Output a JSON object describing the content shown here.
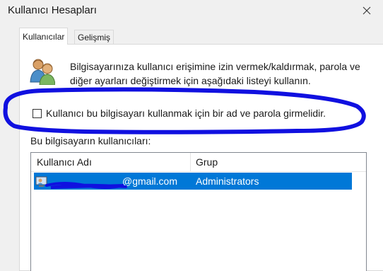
{
  "window": {
    "title": "Kullanıcı Hesapları",
    "close_icon": "close-icon"
  },
  "tabs": [
    {
      "label": "Kullanıcılar",
      "active": true
    },
    {
      "label": "Gelişmiş",
      "active": false
    }
  ],
  "description": "Bilgisayarınıza kullanıcı erişimine izin vermek/kaldırmak, parola ve diğer ayarları değiştirmek için aşağıdaki listeyi kullanın.",
  "require_password": {
    "label": "Kullanıcı bu bilgisayarı kullanmak için bir ad ve parola girmelidir.",
    "checked": false
  },
  "users_section": {
    "label": "Bu bilgisayarın kullanıcıları:",
    "columns": [
      "Kullanıcı Adı",
      "Grup"
    ],
    "rows": [
      {
        "user": "@gmail.com",
        "group": "Administrators",
        "selected": true
      }
    ]
  },
  "colors": {
    "selection": "#0078d7",
    "annotation": "#1010e0"
  }
}
